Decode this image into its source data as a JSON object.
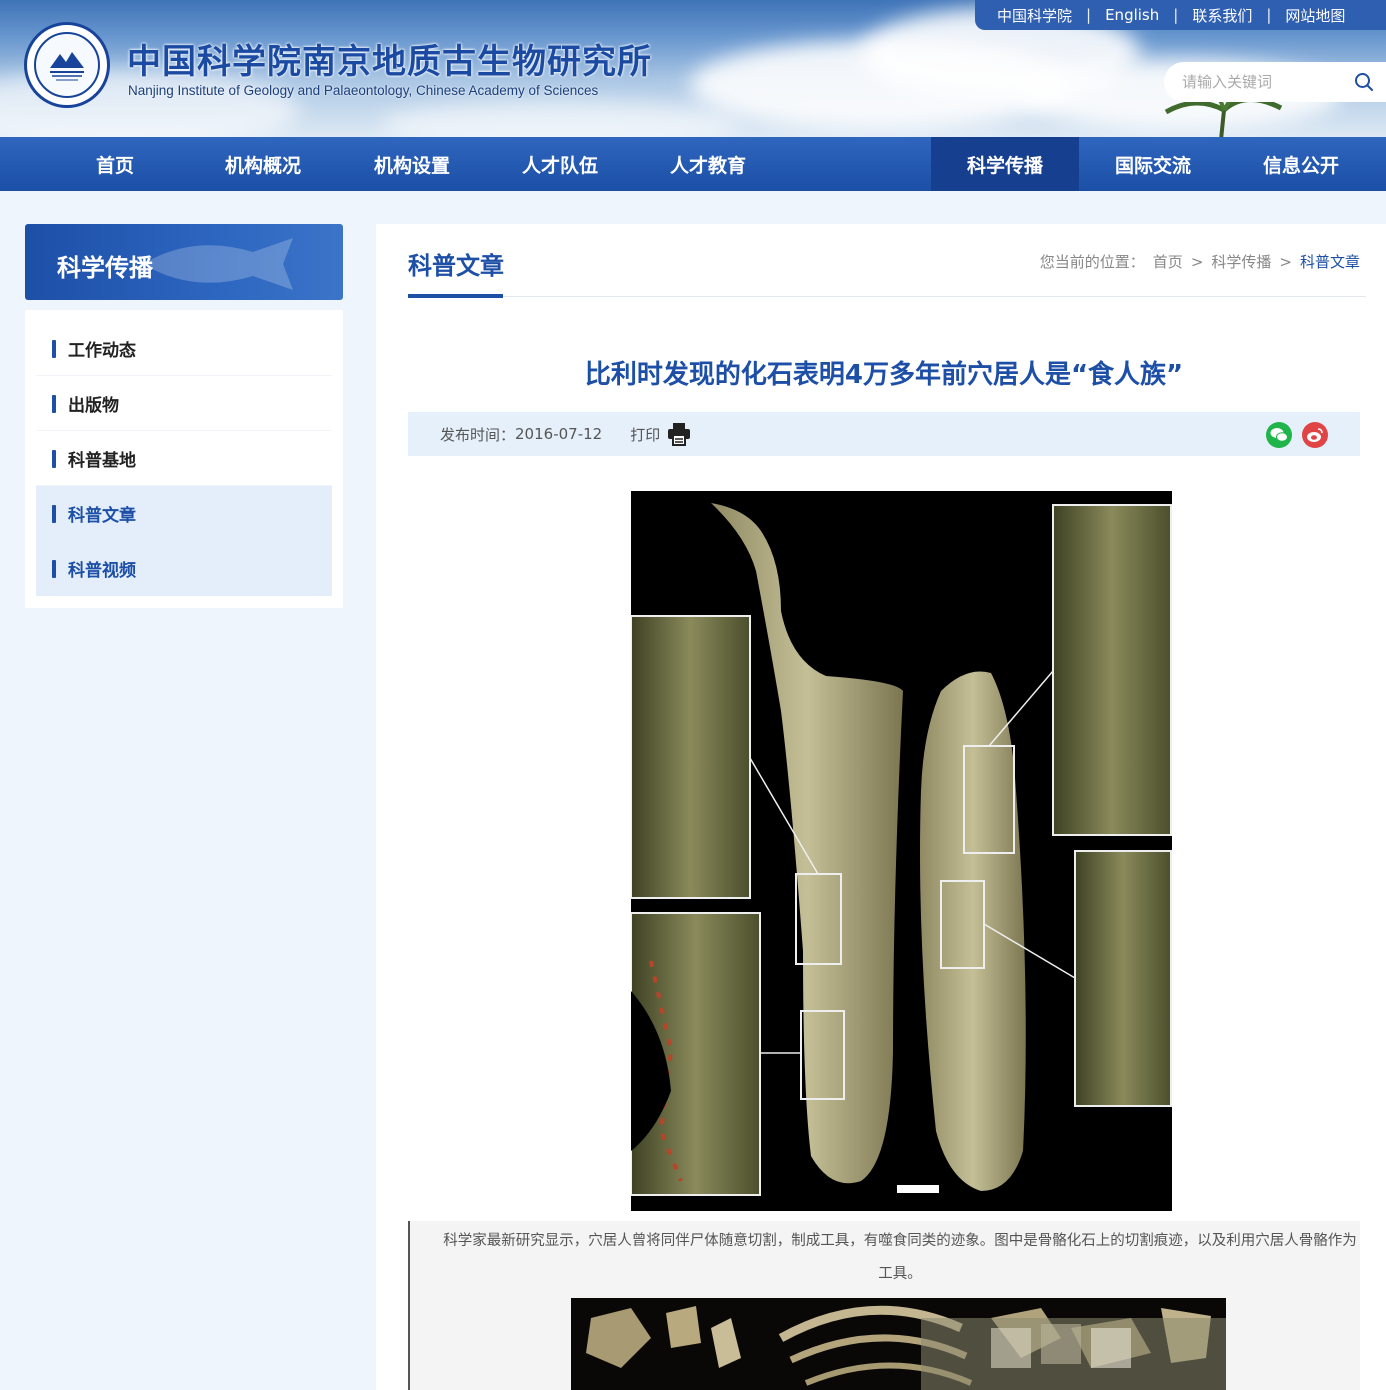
{
  "header": {
    "title_cn": "中国科学院南京地质古生物研究所",
    "title_en": "Nanjing Institute of Geology and Palaeontology, Chinese Academy of Sciences",
    "top_links": [
      "中国科学院",
      "English",
      "联系我们",
      "网站地图"
    ],
    "separator": "|",
    "search_placeholder": "请输入关键词"
  },
  "nav": {
    "items": [
      "首页",
      "机构概况",
      "机构设置",
      "人才队伍",
      "人才教育",
      "",
      "科学传播",
      "国际交流",
      "信息公开"
    ],
    "active_index": 6
  },
  "sidebar": {
    "title": "科学传播",
    "items": [
      "工作动态",
      "出版物",
      "科普基地",
      "科普文章",
      "科普视频"
    ],
    "active_index": 3
  },
  "main": {
    "section_title": "科普文章",
    "breadcrumb": {
      "prefix": "您当前的位置：",
      "home": "首页",
      "sep": ">",
      "level1": "科学传播",
      "current": "科普文章"
    },
    "article": {
      "title": "比利时发现的化石表明4万多年前穴居人是“食人族”",
      "publish_label": "发布时间：",
      "publish_date": "2016-07-12",
      "print_label": "打印",
      "caption": "科学家最新研究显示，穴居人曾将同伴尸体随意切割，制成工具，有噬食同类的迹象。图中是骨骼化石上的切割痕迹，以及利用穴居人骨骼作为工具。"
    }
  },
  "colors": {
    "primary": "#1d4fa7",
    "nav_bg": "#1c4fa6",
    "nav_active": "#173f8f",
    "meta_bg": "#e6f0fb",
    "page_bg": "#eef5fc",
    "wechat": "#20b44a",
    "weibo": "#e14444"
  }
}
